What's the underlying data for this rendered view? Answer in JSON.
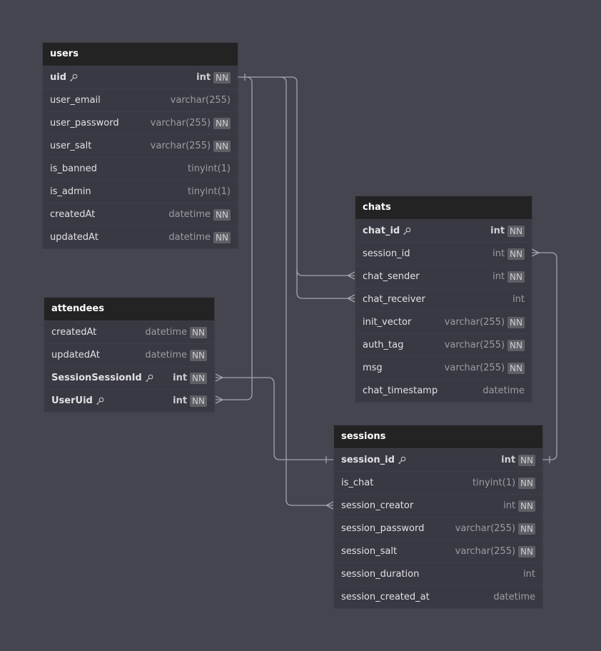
{
  "tables": {
    "users": {
      "name": "users",
      "fields": [
        {
          "name": "uid",
          "type": "int",
          "nn": "NN",
          "pk": true
        },
        {
          "name": "user_email",
          "type": "varchar(255)",
          "nn": ""
        },
        {
          "name": "user_password",
          "type": "varchar(255)",
          "nn": "NN"
        },
        {
          "name": "user_salt",
          "type": "varchar(255)",
          "nn": "NN"
        },
        {
          "name": "is_banned",
          "type": "tinyint(1)",
          "nn": ""
        },
        {
          "name": "is_admin",
          "type": "tinyint(1)",
          "nn": ""
        },
        {
          "name": "createdAt",
          "type": "datetime",
          "nn": "NN"
        },
        {
          "name": "updatedAt",
          "type": "datetime",
          "nn": "NN"
        }
      ]
    },
    "attendees": {
      "name": "attendees",
      "fields": [
        {
          "name": "createdAt",
          "type": "datetime",
          "nn": "NN"
        },
        {
          "name": "updatedAt",
          "type": "datetime",
          "nn": "NN"
        },
        {
          "name": "SessionSessionId",
          "type": "int",
          "nn": "NN",
          "pk": true
        },
        {
          "name": "UserUid",
          "type": "int",
          "nn": "NN",
          "pk": true
        }
      ]
    },
    "chats": {
      "name": "chats",
      "fields": [
        {
          "name": "chat_id",
          "type": "int",
          "nn": "NN",
          "pk": true
        },
        {
          "name": "session_id",
          "type": "int",
          "nn": "NN"
        },
        {
          "name": "chat_sender",
          "type": "int",
          "nn": "NN"
        },
        {
          "name": "chat_receiver",
          "type": "int",
          "nn": ""
        },
        {
          "name": "init_vector",
          "type": "varchar(255)",
          "nn": "NN"
        },
        {
          "name": "auth_tag",
          "type": "varchar(255)",
          "nn": "NN"
        },
        {
          "name": "msg",
          "type": "varchar(255)",
          "nn": "NN"
        },
        {
          "name": "chat_timestamp",
          "type": "datetime",
          "nn": ""
        }
      ]
    },
    "sessions": {
      "name": "sessions",
      "fields": [
        {
          "name": "session_id",
          "type": "int",
          "nn": "NN",
          "pk": true
        },
        {
          "name": "is_chat",
          "type": "tinyint(1)",
          "nn": "NN"
        },
        {
          "name": "session_creator",
          "type": "int",
          "nn": "NN"
        },
        {
          "name": "session_password",
          "type": "varchar(255)",
          "nn": "NN"
        },
        {
          "name": "session_salt",
          "type": "varchar(255)",
          "nn": "NN"
        },
        {
          "name": "session_duration",
          "type": "int",
          "nn": ""
        },
        {
          "name": "session_created_at",
          "type": "datetime",
          "nn": ""
        }
      ]
    }
  },
  "relationships": [
    {
      "from": "users.uid",
      "to": "attendees.UserUid",
      "type": "one-to-many"
    },
    {
      "from": "users.uid",
      "to": "sessions.session_creator",
      "type": "one-to-many"
    },
    {
      "from": "users.uid",
      "to": "chats.chat_sender",
      "type": "one-to-many"
    },
    {
      "from": "users.uid",
      "to": "chats.chat_receiver",
      "type": "one-to-many"
    },
    {
      "from": "sessions.session_id",
      "to": "attendees.SessionSessionId",
      "type": "one-to-many"
    },
    {
      "from": "sessions.session_id",
      "to": "chats.session_id",
      "type": "one-to-many"
    }
  ],
  "colors": {
    "background": "#45454f",
    "header": "#232323",
    "row": "#393943",
    "line": "#a3a3ad"
  }
}
